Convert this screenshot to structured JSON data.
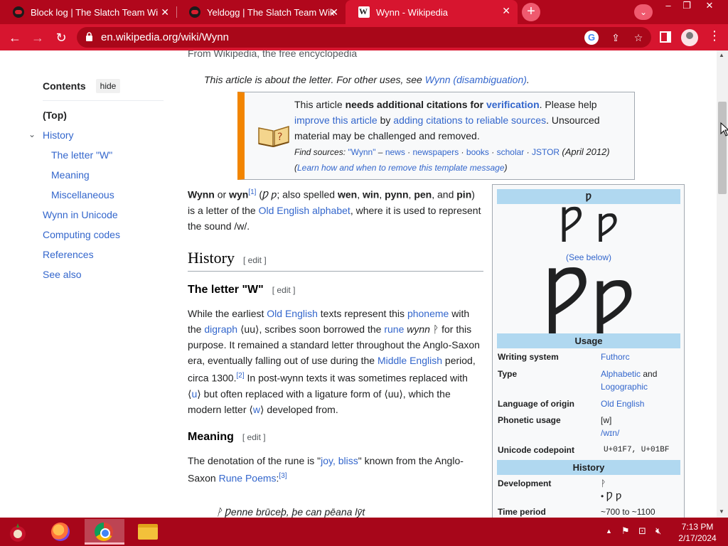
{
  "browser": {
    "tabs": [
      {
        "title": "Block log | The Slatch Team Wiki"
      },
      {
        "title": "Yeldogg | The Slatch Team Wiki |"
      },
      {
        "title": "Wynn - Wikipedia"
      }
    ],
    "new_tab_symbol": "+",
    "url": "en.wikipedia.org/wiki/Wynn",
    "accent_color": "#d7152f",
    "icons": [
      "back-icon",
      "forward-icon",
      "reload-icon",
      "lock-icon",
      "google-lens-icon",
      "share-icon",
      "bookmark-star-icon",
      "side-panel-icon",
      "profile-icon",
      "menu-icon"
    ]
  },
  "page": {
    "tagline": "From Wikipedia, the free encyclopedia",
    "hatnote": {
      "prefix": "This article is about the letter. For other uses, see ",
      "link": "Wynn (disambiguation)",
      "suffix": "."
    },
    "toc": {
      "title": "Contents",
      "hide_label": "hide",
      "items": [
        {
          "label": "(Top)"
        },
        {
          "label": "History"
        },
        {
          "label": "The letter \"W\""
        },
        {
          "label": "Meaning"
        },
        {
          "label": "Miscellaneous"
        },
        {
          "label": "Wynn in Unicode"
        },
        {
          "label": "Computing codes"
        },
        {
          "label": "References"
        },
        {
          "label": "See also"
        }
      ]
    },
    "ambox": {
      "t1": "This article ",
      "t2": "needs additional citations for ",
      "t3": "verification",
      "t4": ". Please help ",
      "t5": "improve this article",
      "t6": " by ",
      "t7": "adding citations to reliable sources",
      "t8": ". Unsourced material may be challenged and removed.",
      "find_sources": "Find sources:",
      "fs_query": "\"Wynn\"",
      "fs_dash": " – ",
      "fs_news": "news",
      "fs_newspapers": "newspapers",
      "fs_books": "books",
      "fs_scholar": "scholar",
      "fs_jstor": "JSTOR",
      "fs_date": "(April 2012)",
      "learn_open": "(",
      "learn_link": "Learn how and when to remove this template message",
      "learn_close": ")"
    },
    "lead": {
      "w1": "Wynn",
      "w2": " or ",
      "w3": "wyn",
      "ref1": "[1]",
      "w4": " (",
      "w5": "Ƿ ƿ",
      "w6": "; also spelled ",
      "w7": "wen",
      "w8": ", ",
      "w9": "win",
      "w10": ", ",
      "w11": "pynn",
      "w12": ", ",
      "w13": "pen",
      "w14": ", and ",
      "w15": "pin",
      "w16": ") is a letter of the ",
      "w17": "Old English alphabet",
      "w18": ", where it is used to represent the sound /w/."
    },
    "history": {
      "heading": "History",
      "edit": "[ edit ]"
    },
    "letter_w": {
      "heading": "The letter \"W\"",
      "edit": "[ edit ]",
      "p1": "While the earliest ",
      "p2": "Old English",
      "p3": " texts represent this ",
      "p4": "phoneme",
      "p5": " with the ",
      "p6": "digraph",
      "p7": " ⟨uu⟩, scribes soon borrowed the ",
      "p8": "rune",
      "p9": " ",
      "p10": "wynn",
      "p11": " ᚹ for this purpose. It remained a standard letter throughout the Anglo-Saxon era, eventually falling out of use during the ",
      "p12": "Middle English",
      "p13": " period, circa 1300.",
      "ref2": "[2]",
      "p14": " In post-wynn texts it was sometimes replaced with ⟨",
      "p15": "u",
      "p16": "⟩ but often replaced with a ligature form of ⟨uu⟩, which the modern letter ⟨",
      "p17": "w",
      "p18": "⟩ developed from."
    },
    "meaning": {
      "heading": "Meaning",
      "edit": "[ edit ]",
      "p1": "The denotation of the rune is \"",
      "p2": "joy, bliss",
      "p3": "\" known from the Anglo-Saxon ",
      "p4": "Rune Poems",
      "p5": ":",
      "ref3": "[3]",
      "poem": "ᚹ Ƿenne brūceþ, þe can pēana lӯt"
    },
    "infobox": {
      "title": "Ƿ",
      "glyph_small": "Ƿ ƿ",
      "see_below": "(See below)",
      "glyph_big": "Ƿƿ",
      "usage_header": "Usage",
      "rows": [
        {
          "label": "Writing system",
          "value": "Futhorc"
        },
        {
          "label": "Type",
          "value_a": "Alphabetic",
          "value_b": " and ",
          "value_c": "Logographic"
        },
        {
          "label": "Language of origin",
          "value": "Old English"
        },
        {
          "label": "Phonetic usage",
          "value_a": "[w]",
          "value_b": "/wɪn/"
        },
        {
          "label": "Unicode codepoint",
          "value": "U+01F7, U+01BF"
        }
      ],
      "history_header": "History",
      "history_rows": [
        {
          "label": "Development",
          "value_a": "ᚹ",
          "value_b": "Ƿ ƿ"
        },
        {
          "label": "Time period",
          "value": "~700 to ~1100"
        }
      ],
      "header_color": "#b0d8f0"
    }
  },
  "taskbar": {
    "apps": [
      "firefox-icon",
      "chrome-icon",
      "file-explorer-icon"
    ],
    "time": "7:13 PM",
    "date": "2/17/2024"
  }
}
